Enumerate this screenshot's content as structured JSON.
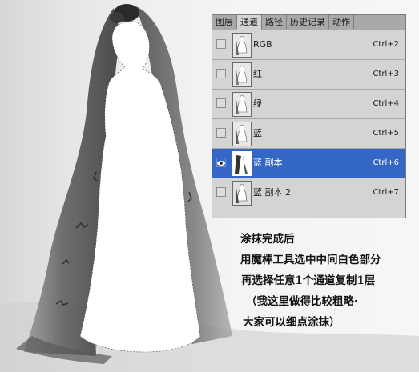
{
  "panel": {
    "tabs": [
      {
        "label": "图层",
        "active": false
      },
      {
        "label": "通道",
        "active": true
      },
      {
        "label": "路径",
        "active": false
      },
      {
        "label": "历史记录",
        "active": false
      },
      {
        "label": "动作",
        "active": false
      }
    ],
    "channels": [
      {
        "name": "RGB",
        "shortcut": "Ctrl+2",
        "visible": false,
        "selected": false
      },
      {
        "name": "红",
        "shortcut": "Ctrl+3",
        "visible": false,
        "selected": false
      },
      {
        "name": "绿",
        "shortcut": "Ctrl+4",
        "visible": false,
        "selected": false
      },
      {
        "name": "蓝",
        "shortcut": "Ctrl+5",
        "visible": false,
        "selected": false
      },
      {
        "name": "蓝 副本",
        "shortcut": "Ctrl+6",
        "visible": true,
        "selected": true
      },
      {
        "name": "蓝 副本 2",
        "shortcut": "Ctrl+7",
        "visible": false,
        "selected": false
      }
    ],
    "icons": {
      "visibility": "eye-icon",
      "thumbnail": "channel-thumbnail"
    }
  },
  "note": {
    "lines": [
      "涂抹完成后",
      "用魔棒工具选中中间白色部分",
      "再选择任意1个通道复制1层",
      "（我这里做得比较粗略·",
      "大家可以细点涂抹）"
    ]
  },
  "colors": {
    "selected_row": "#3466c6",
    "panel_bg": "#d4d4d4",
    "tab_bar": "#a9a9a9",
    "figure_fill": "#ffffff",
    "veil_dark": "#3a3a3a"
  }
}
